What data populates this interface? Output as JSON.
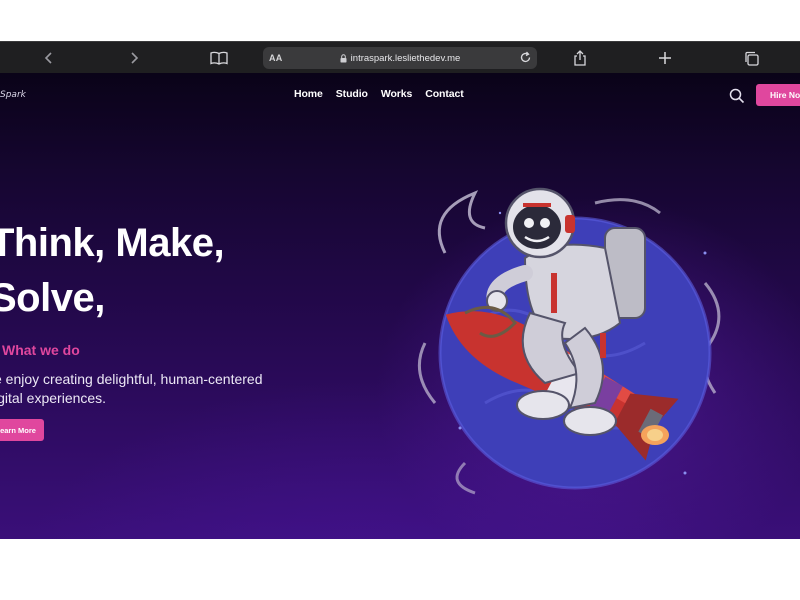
{
  "browser": {
    "url_aa": "AA",
    "url": "intraspark.lesliethedev.me",
    "icons": [
      "chevron-left-icon",
      "chevron-right-icon",
      "book-icon",
      "lock-icon",
      "reload-icon",
      "share-icon",
      "plus-icon",
      "tabs-icon"
    ]
  },
  "site": {
    "logo": "Spark",
    "nav": [
      "Home",
      "Studio",
      "Works",
      "Contact"
    ],
    "hire_button": "Hire Now",
    "hero": {
      "title_line1": "Think, Make,",
      "title_line2": "Solve,",
      "subtitle": "What we do",
      "desc_line1": "e enjoy creating delightful, human-centered",
      "desc_line2": "igital experiences.",
      "cta": "earn More"
    },
    "illustration": "astronaut riding a rocket in front of a blue planet",
    "colors": {
      "accent": "#e0479e",
      "background": "#1a0737",
      "chrome": "#1f1f21"
    }
  }
}
